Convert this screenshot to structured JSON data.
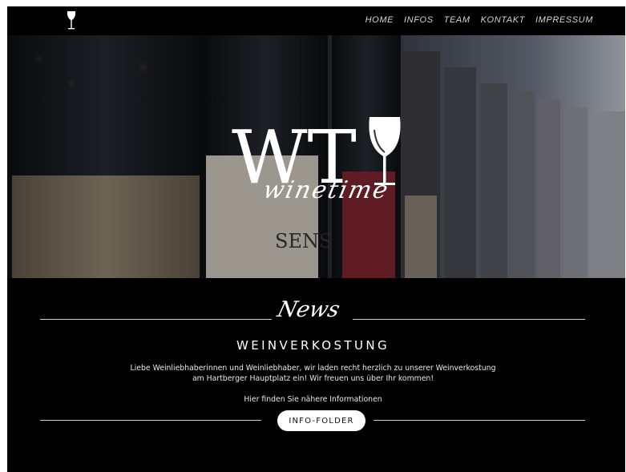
{
  "nav": {
    "items": [
      {
        "label": "HOME"
      },
      {
        "label": "INFOS"
      },
      {
        "label": "TEAM"
      },
      {
        "label": "KONTAKT"
      },
      {
        "label": "IMPRESSUM"
      }
    ],
    "logo_icon": "wine-glass-icon"
  },
  "hero": {
    "brand_letters": "WT",
    "brand_script": "winetime",
    "bottle_label": "SENS",
    "logo_icon": "wine-glass-icon"
  },
  "news": {
    "heading": "News",
    "title": "WEINVERKOSTUNG",
    "text_line1": "Liebe Weinliebhaberinnen und Weinliebhaber, wir laden recht herzlich zu unserer Weinverkostung",
    "text_line2": "am Hartberger Hauptplatz ein! Wir freuen uns über Ihr kommen!",
    "text_line3": "Hier finden Sie nähere Informationen",
    "button_label": "INFO-FOLDER"
  },
  "colors": {
    "background": "#000000",
    "text": "#ffffff",
    "button_bg": "#ffffff",
    "divider": "#cfcfcf"
  }
}
